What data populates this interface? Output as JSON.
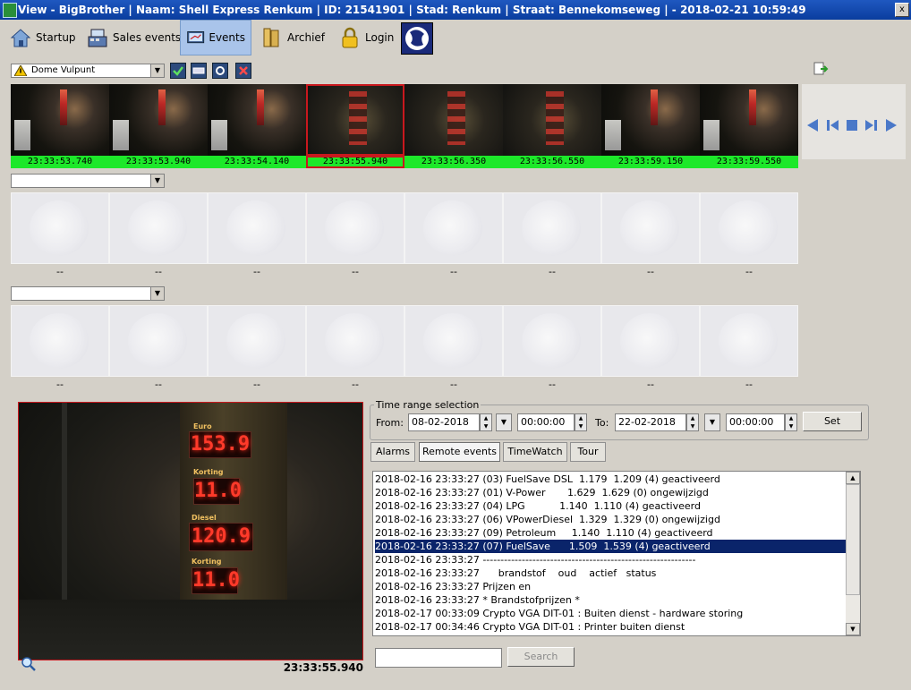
{
  "window": {
    "title": "View - BigBrother | Naam: Shell  Express Renkum | ID: 21541901 | Stad: Renkum | Straat: Bennekomseweg |  - 2018-02-21 10:59:49",
    "close_glyph": "x"
  },
  "toolbar": {
    "startup_label": "Startup",
    "sales_events_label": "Sales events",
    "events_label": "Events",
    "archief_label": "Archief",
    "login_label": "Login"
  },
  "camera1": {
    "selected": "Dome Vulpunt",
    "timestamps": [
      "23:33:53.740",
      "23:33:53.940",
      "23:33:54.140",
      "23:33:55.940",
      "23:33:56.350",
      "23:33:56.550",
      "23:33:59.150",
      "23:33:59.550"
    ],
    "selected_index": 3
  },
  "camera2": {
    "selected": "",
    "labels": [
      "--",
      "--",
      "--",
      "--",
      "--",
      "--",
      "--",
      "--"
    ]
  },
  "camera3": {
    "selected": "",
    "labels": [
      "--",
      "--",
      "--",
      "--",
      "--",
      "--",
      "--",
      "--"
    ]
  },
  "main_image": {
    "timestamp": "23:33:55.940",
    "sign": {
      "label1": "Euro",
      "price1": "153.9",
      "label2": "Korting",
      "price2": "11.0",
      "label3": "Diesel",
      "price3": "120.9",
      "label4": "Korting",
      "price4": "11.0"
    }
  },
  "time_range": {
    "legend": "Time range selection",
    "from_label": "From:",
    "from_date": "08-02-2018",
    "from_time": "00:00:00",
    "to_label": "To:",
    "to_date": "22-02-2018",
    "to_time": "00:00:00",
    "set_label": "Set"
  },
  "tabs": [
    {
      "label": "Alarms"
    },
    {
      "label": "Remote events"
    },
    {
      "label": "TimeWatch"
    },
    {
      "label": "Tour"
    }
  ],
  "events": [
    "2018-02-16 23:33:27 (03) FuelSave DSL  1.179  1.209 (4) geactiveerd",
    "2018-02-16 23:33:27 (01) V-Power       1.629  1.629 (0) ongewijzigd",
    "2018-02-16 23:33:27 (04) LPG           1.140  1.110 (4) geactiveerd",
    "2018-02-16 23:33:27 (06) VPowerDiesel  1.329  1.329 (0) ongewijzigd",
    "2018-02-16 23:33:27 (09) Petroleum     1.140  1.110 (4) geactiveerd",
    "2018-02-16 23:33:27 (07) FuelSave      1.509  1.539 (4) geactiveerd",
    "2018-02-16 23:33:27 ------------------------------------------------------------",
    "2018-02-16 23:33:27      brandstof    oud    actief   status",
    "2018-02-16 23:33:27 Prijzen en",
    "2018-02-16 23:33:27 * Brandstofprijzen *",
    "2018-02-17 00:33:09 Crypto VGA DIT-01 : Buiten dienst - hardware storing",
    "2018-02-17 00:34:46 Crypto VGA DIT-01 : Printer buiten dienst"
  ],
  "selected_event_index": 5,
  "search": {
    "value": "",
    "button_label": "Search"
  },
  "colors": {
    "selection": "#0a246a",
    "timestamp_bg": "#1de82a",
    "selected_frame": "#c8181e",
    "titlebar": "#0a3d9e"
  }
}
